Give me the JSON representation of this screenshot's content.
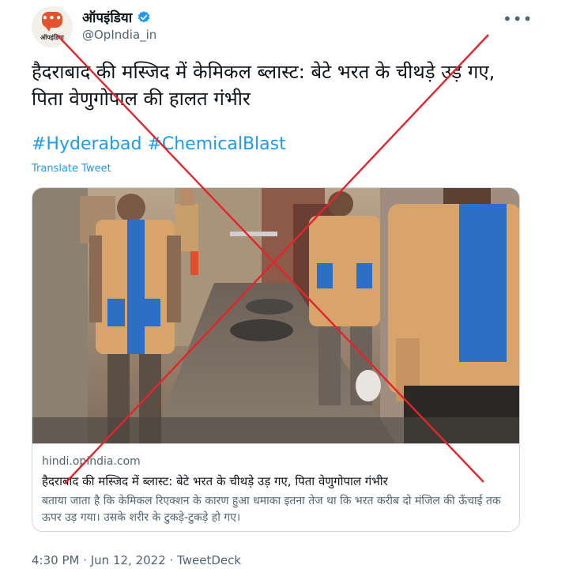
{
  "author": {
    "display_name": "ऑपइंडिया",
    "handle": "@OpIndia_in",
    "avatar_label": "ऑपइंडिया",
    "avatar_icon": "speech-bubble-icon",
    "verified_icon": "verified-badge-icon"
  },
  "tweet": {
    "text": "हैदराबाद की मस्जिद में केमिकल ब्लास्ट: बेटे भरत के चीथड़े उड़ गए, पिता वेणुगोपाल की हालत गंभीर",
    "hashtags": [
      "#Hyderabad",
      "#ChemicalBlast"
    ],
    "translate_label": "Translate Tweet",
    "timestamp": "4:30 PM · Jun 12, 2022 · TweetDeck"
  },
  "card": {
    "domain": "hindi.opindia.com",
    "title": "हैदराबाद की मस्जिद में ब्लास्ट: बेटे भरत के चीथड़े उड़ गए, पिता वेणुगोपाल गंभीर",
    "description": "बताया जाता है कि केमिकल रिएक्शन के कारण हुआ धमाका इतना तेज था कि भरत करीब दो मंजिल की ऊँचाई तक ऊपर उड़ गया। उसके शरीर के टुकड़े-टुकड़े हो गए।"
  },
  "menu": {
    "more_label": "•••"
  },
  "colors": {
    "accent": "#1d9bf0",
    "cross": "#e3252b",
    "vest": "#d9a46c",
    "vest_pocket": "#2d6fc4"
  }
}
